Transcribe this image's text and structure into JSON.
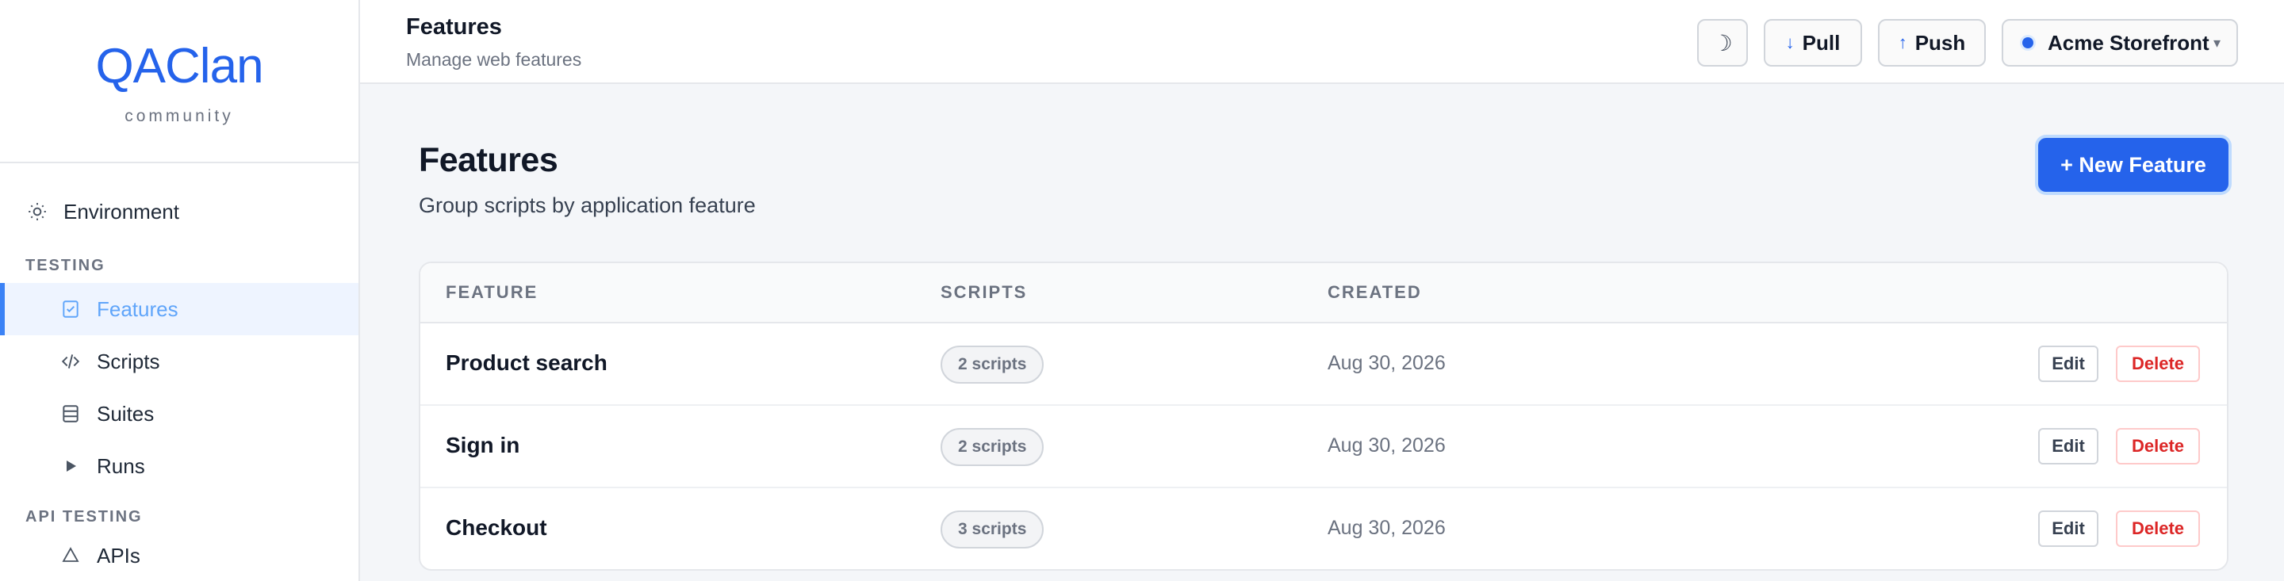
{
  "brand": {
    "logo": "QAClan",
    "tagline": "community"
  },
  "sidebar": {
    "environment": "Environment",
    "section_testing": "TESTING",
    "items": [
      {
        "label": "Features",
        "icon": "checklist-icon",
        "active": true
      },
      {
        "label": "Scripts",
        "icon": "code-icon"
      },
      {
        "label": "Suites",
        "icon": "layers-icon"
      },
      {
        "label": "Runs",
        "icon": "play-icon"
      }
    ],
    "section_api": "API TESTING",
    "partial_item": "APIs"
  },
  "topbar": {
    "title": "Features",
    "subtitle": "Manage web features",
    "theme_icon": "☽",
    "pull": "Pull",
    "push": "Push",
    "project": "Acme Storefront"
  },
  "main": {
    "title": "Features",
    "subtitle": "Group scripts by application feature",
    "new_button": "+ New Feature",
    "table": {
      "headers": [
        "FEATURE",
        "SCRIPTS",
        "CREATED"
      ],
      "rows": [
        {
          "feature": "Product search",
          "scripts": "2 scripts",
          "created": "Aug 30, 2026",
          "edit": "Edit",
          "delete": "Delete"
        },
        {
          "feature": "Sign in",
          "scripts": "2 scripts",
          "created": "Aug 30, 2026",
          "edit": "Edit",
          "delete": "Delete"
        },
        {
          "feature": "Checkout",
          "scripts": "3 scripts",
          "created": "Aug 30, 2026",
          "edit": "Edit",
          "delete": "Delete"
        }
      ]
    }
  },
  "colors": {
    "accent": "#2563eb",
    "danger": "#dc2626",
    "active_bg": "#eef4ff"
  }
}
